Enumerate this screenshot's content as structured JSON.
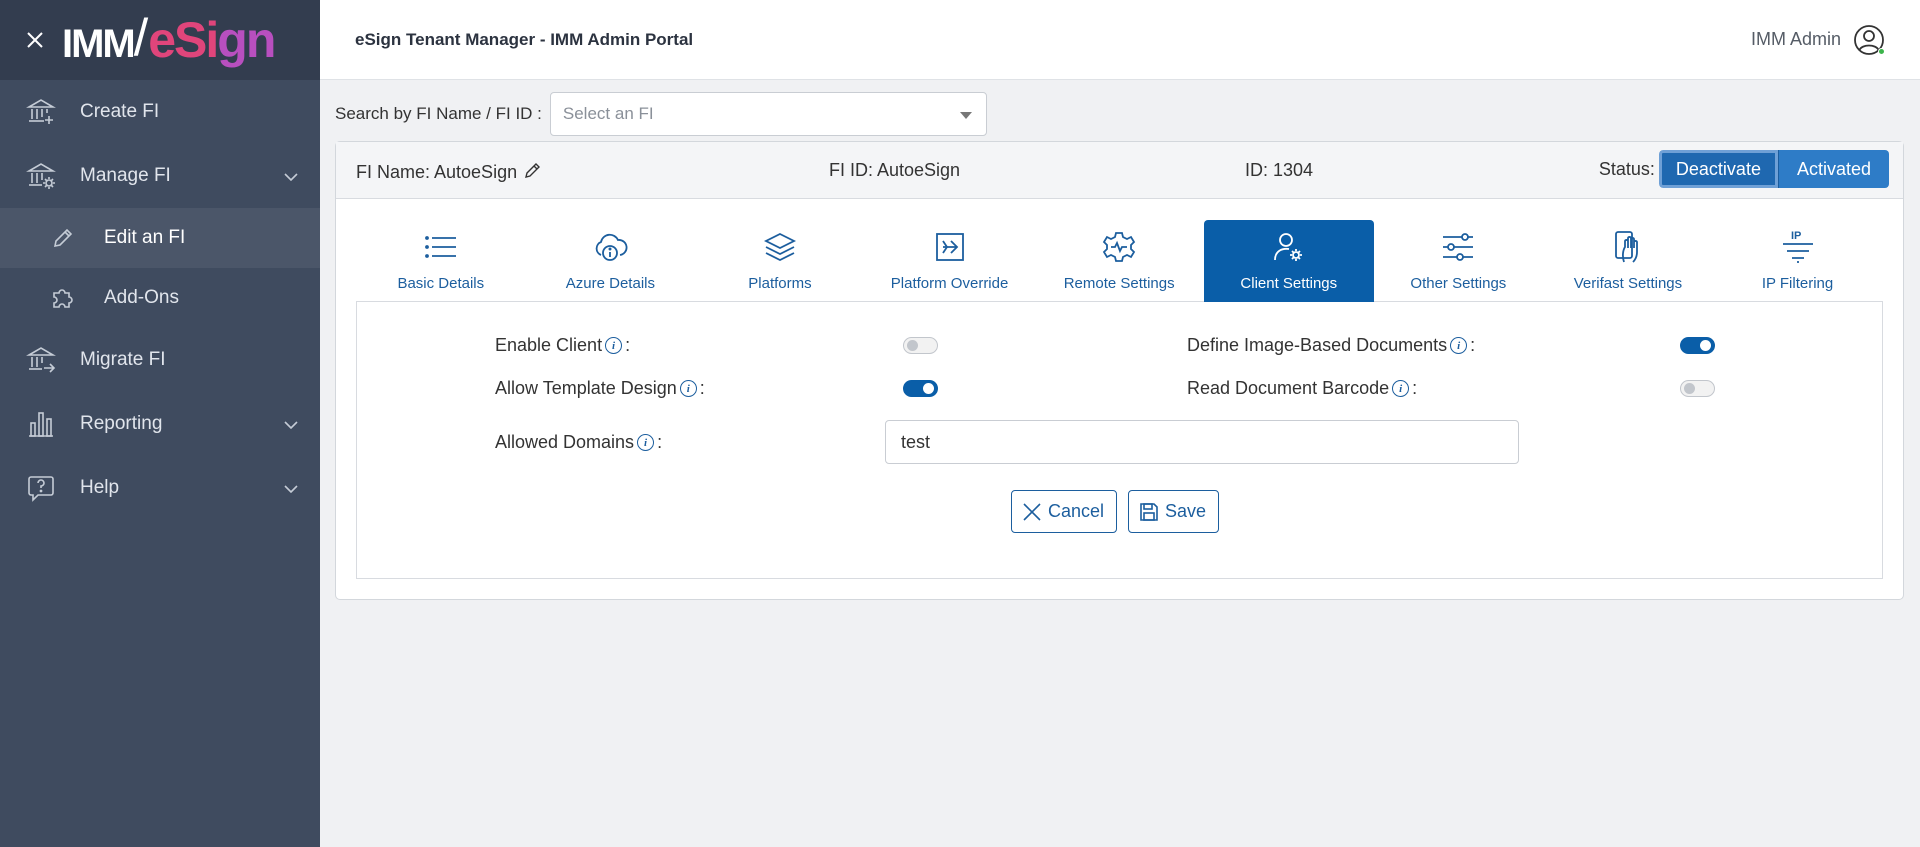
{
  "brand": {
    "imm": "IMM",
    "slash": "/",
    "esign_prefix": "eSi",
    "esign_suffix": "gn"
  },
  "header": {
    "title": "eSign Tenant Manager - IMM Admin Portal",
    "user_name": "IMM Admin"
  },
  "sidebar": {
    "items": [
      {
        "label": "Create FI",
        "icon": "bank-plus-icon"
      },
      {
        "label": "Manage FI",
        "icon": "bank-gear-icon",
        "expandable": true
      },
      {
        "label": "Edit an FI",
        "icon": "pencil-icon",
        "active": true
      },
      {
        "label": "Add-Ons",
        "icon": "puzzle-icon"
      },
      {
        "label": "Migrate FI",
        "icon": "bank-arrow-icon"
      },
      {
        "label": "Reporting",
        "icon": "bar-chart-icon",
        "expandable": true
      },
      {
        "label": "Help",
        "icon": "help-bubble-icon",
        "expandable": true
      }
    ]
  },
  "search": {
    "label": "Search by FI Name / FI ID :",
    "placeholder": "Select an FI"
  },
  "fi": {
    "name_label": "FI Name: AutoeSign",
    "id_label": "FI ID: AutoeSign",
    "numeric_id_label": "ID: 1304",
    "status_label": "Status:",
    "deactivate_label": "Deactivate",
    "activated_label": "Activated"
  },
  "tabs": [
    {
      "label": "Basic Details",
      "icon": "list-icon"
    },
    {
      "label": "Azure Details",
      "icon": "cloud-info-icon"
    },
    {
      "label": "Platforms",
      "icon": "layers-icon"
    },
    {
      "label": "Platform Override",
      "icon": "arrow-box-icon"
    },
    {
      "label": "Remote Settings",
      "icon": "gear-wave-icon"
    },
    {
      "label": "Client Settings",
      "icon": "user-gear-icon",
      "active": true
    },
    {
      "label": "Other Settings",
      "icon": "sliders-icon"
    },
    {
      "label": "Verifast Settings",
      "icon": "hand-phone-icon"
    },
    {
      "label": "IP Filtering",
      "icon": "ip-filter-icon"
    }
  ],
  "client_settings": {
    "enable_client": {
      "label": "Enable Client",
      "suffix": ":",
      "enabled": false
    },
    "allow_template_design": {
      "label": "Allow Template Design",
      "suffix": ":",
      "enabled": true
    },
    "define_image_based_documents": {
      "label": "Define Image-Based Documents",
      "suffix": ":",
      "enabled": true
    },
    "read_document_barcode": {
      "label": "Read Document Barcode",
      "suffix": ":",
      "enabled": false
    },
    "allowed_domains": {
      "label": "Allowed Domains",
      "suffix": ":",
      "value": "test"
    }
  },
  "actions": {
    "cancel_label": "Cancel",
    "save_label": "Save"
  },
  "colors": {
    "primary": "#0a5ea8",
    "sidebar": "#3f4b5f",
    "sidebar_header": "#333d4f",
    "brand_pink": "#e0457b",
    "online": "#3bb44a"
  }
}
